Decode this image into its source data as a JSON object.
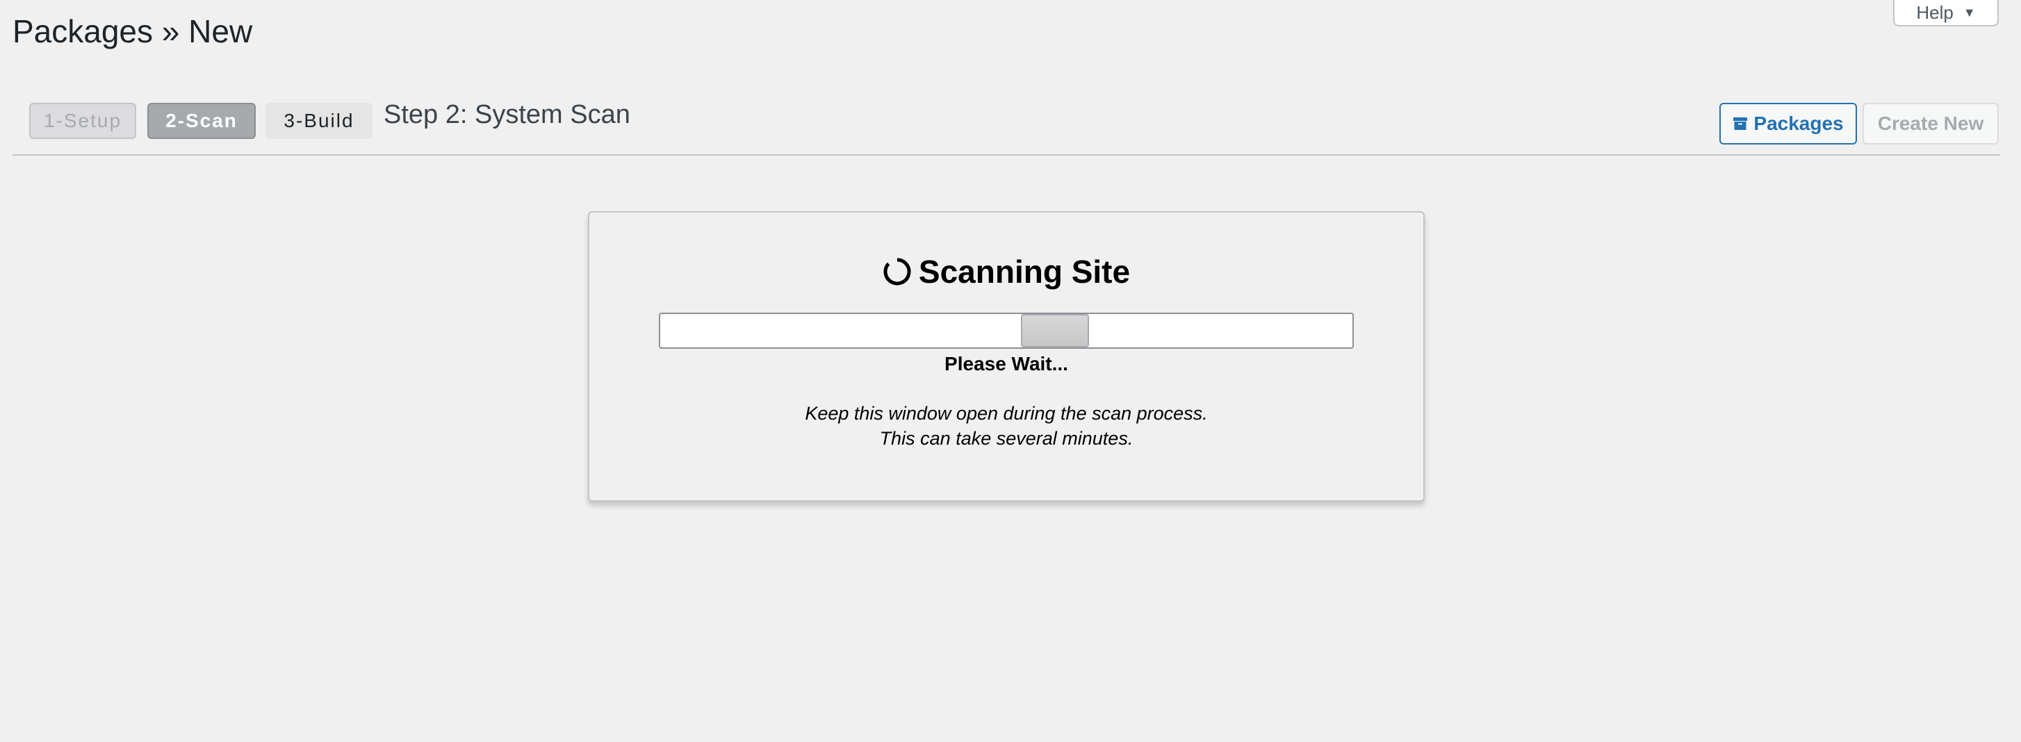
{
  "page": {
    "title": "Packages » New",
    "help_label": "Help"
  },
  "steps": {
    "items": [
      {
        "label": "1-Setup",
        "state": "done"
      },
      {
        "label": "2-Scan",
        "state": "active"
      },
      {
        "label": "3-Build",
        "state": "pending"
      }
    ],
    "current_title": "Step 2: System Scan"
  },
  "actions": {
    "packages_label": "Packages",
    "create_new_label": "Create New"
  },
  "scan": {
    "heading": "Scanning Site",
    "wait_text": "Please Wait...",
    "note_line1": "Keep this window open during the scan process.",
    "note_line2": "This can take several minutes.",
    "indicator_position": 0.57,
    "icon": "spinner-icon"
  },
  "colors": {
    "accent": "#2271b1",
    "background": "#f0f0f1",
    "active_step": "#a7aaad"
  }
}
